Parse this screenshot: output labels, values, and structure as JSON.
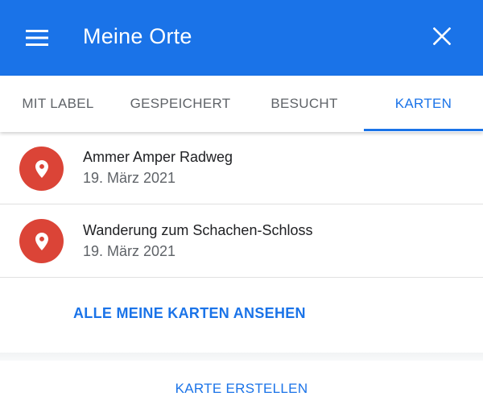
{
  "app_bar": {
    "title": "Meine Orte",
    "menu_icon": "hamburger-menu-icon",
    "close_icon": "close-icon",
    "background": "#1a73e8"
  },
  "tabs": [
    {
      "label": "MIT LABEL",
      "active": false
    },
    {
      "label": "GESPEICHERT",
      "active": false
    },
    {
      "label": "BESUCHT",
      "active": false
    },
    {
      "label": "KARTEN",
      "active": true
    }
  ],
  "maps": [
    {
      "title": "Ammer Amper Radweg",
      "date": "19. März 2021",
      "icon": "map-pin-icon"
    },
    {
      "title": "Wanderung zum Schachen-Schloss",
      "date": "19. März 2021",
      "icon": "map-pin-icon"
    }
  ],
  "actions": {
    "view_all_label": "ALLE MEINE KARTEN ANSEHEN",
    "create_label": "KARTE ERSTELLEN"
  },
  "colors": {
    "accent": "#1a73e8",
    "pin": "#db4437"
  }
}
